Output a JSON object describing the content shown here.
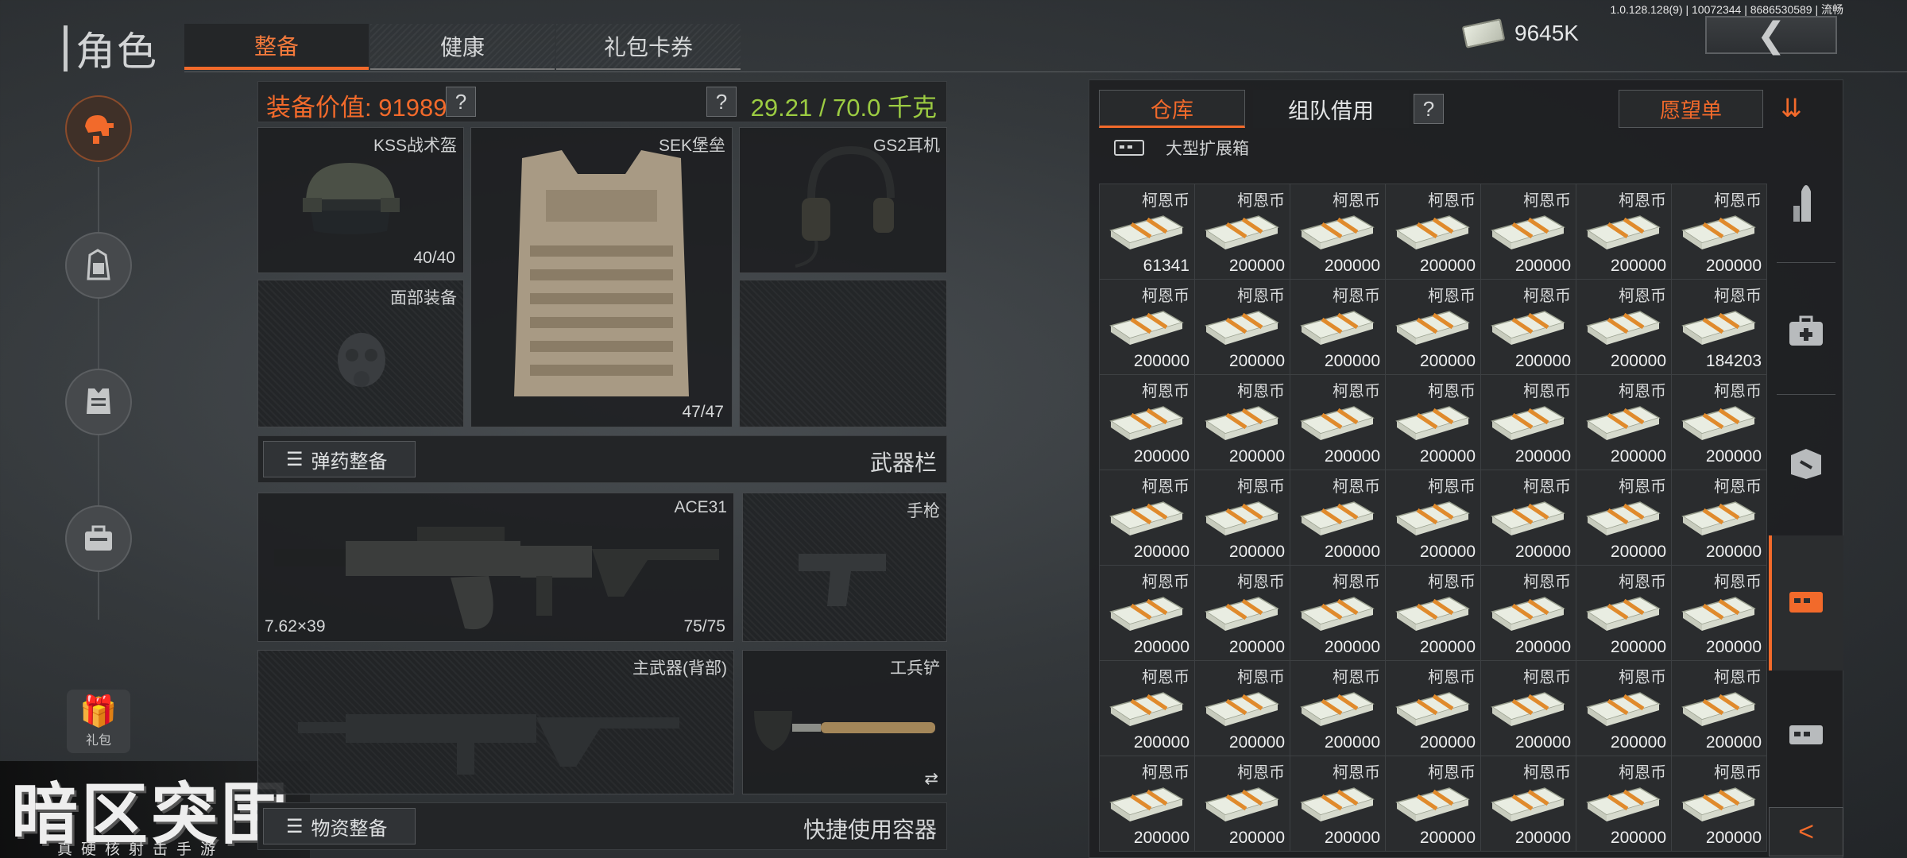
{
  "version": "1.0.128.128(9) | 10072344 | 8686530589 | 流畅",
  "header": {
    "title": "角色",
    "tabs": [
      "整备",
      "健康",
      "礼包卡券"
    ],
    "currency": "9645K",
    "back_icon": "chevron-left-icon"
  },
  "sidebar": {
    "items": [
      "loadout-gear-icon",
      "backpack-icon",
      "armor-icon",
      "medkit-icon"
    ],
    "gift_label": "礼包"
  },
  "logo": {
    "title": "暗区突围",
    "subtitle": "真硬核射击手游"
  },
  "equipment": {
    "value_label": "装备价值: 91989",
    "help": "?",
    "weight": "29.21 / 70.0 千克",
    "helmet": {
      "name": "KSS战术盔",
      "durability": "40/40"
    },
    "vest": {
      "name": "SEK堡垒",
      "durability": "47/47"
    },
    "headset": {
      "name": "GS2耳机"
    },
    "face": {
      "name": "面部装备"
    },
    "ammo_button": "弹药整备",
    "weapons_label": "武器栏",
    "primary": {
      "name": "ACE31",
      "caliber": "7.62×39",
      "ammo": "75/75"
    },
    "pistol": {
      "name": "手枪"
    },
    "primary_back": {
      "name": "主武器(背部)"
    },
    "melee": {
      "name": "工兵铲",
      "swap": "⇄"
    },
    "supply_button": "物资整备",
    "quick_label": "快捷使用容器"
  },
  "warehouse": {
    "tab_active": "仓库",
    "tab_team": "组队借用",
    "help": "?",
    "wishlist": "愿望单",
    "container": "大型扩展箱",
    "item_name": "柯恩币",
    "amounts": [
      "61341",
      "200000",
      "200000",
      "200000",
      "200000",
      "200000",
      "200000",
      "200000",
      "200000",
      "200000",
      "200000",
      "200000",
      "200000",
      "184203",
      "200000",
      "200000",
      "200000",
      "200000",
      "200000",
      "200000",
      "200000",
      "200000",
      "200000",
      "200000",
      "200000",
      "200000",
      "200000",
      "200000",
      "200000",
      "200000",
      "200000",
      "200000",
      "200000",
      "200000",
      "200000",
      "200000",
      "200000",
      "200000",
      "200000",
      "200000",
      "200000",
      "200000",
      "200000",
      "200000",
      "200000",
      "200000",
      "200000",
      "200000",
      "200000"
    ]
  },
  "right_rail": {
    "icons": [
      "ammo-icon",
      "medical-case-icon",
      "supply-box-icon",
      "storage-chest-icon",
      "stash-icon"
    ],
    "back": "<"
  }
}
